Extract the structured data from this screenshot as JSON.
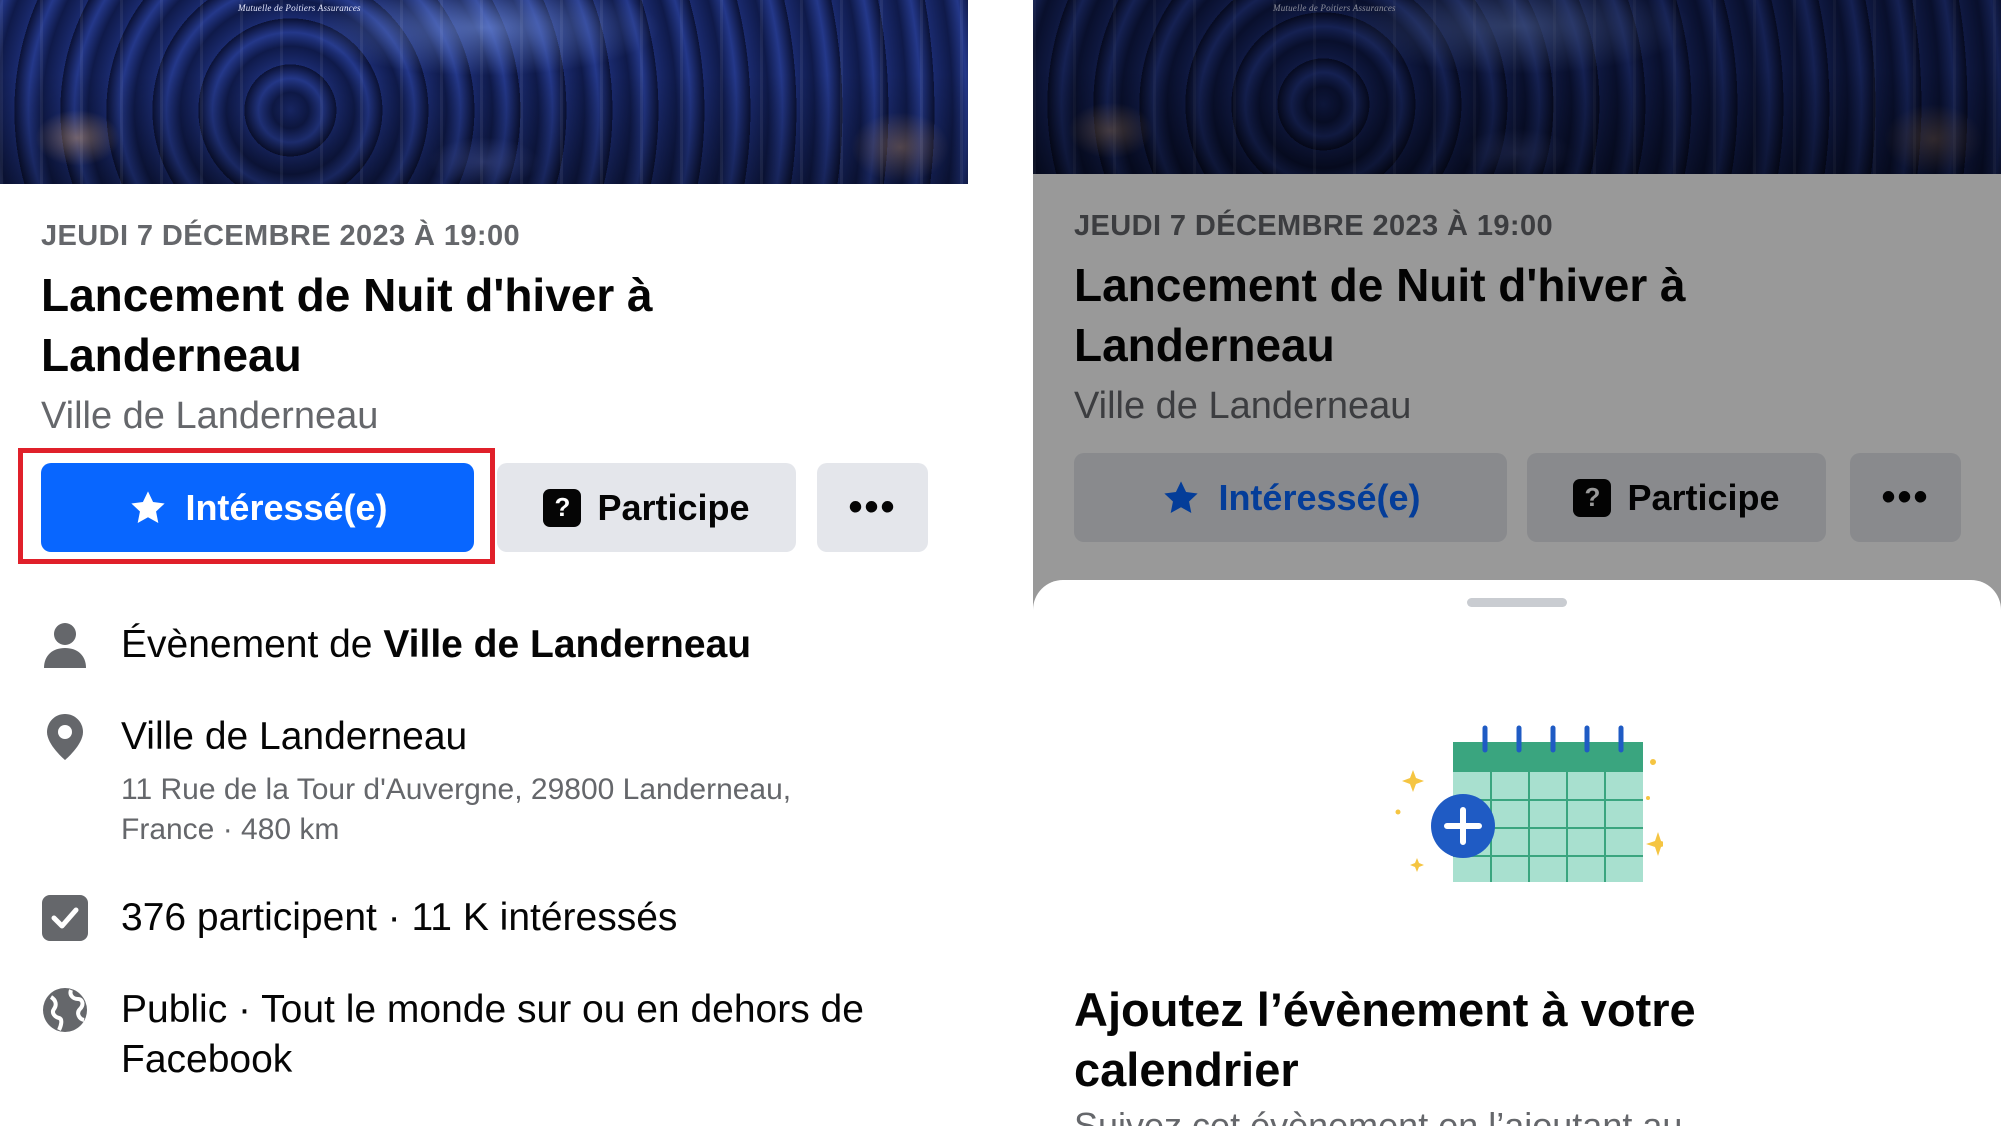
{
  "event": {
    "date": "JEUDI 7 DÉCEMBRE 2023 À 19:00",
    "title_line1": "Lancement de Nuit d'hiver à",
    "title_line2": "Landerneau",
    "host": "Ville de Landerneau",
    "cover_sign": "Mutuelle de Poitiers Assurances"
  },
  "actions": {
    "interested_label": "Intéressé(e)",
    "participe_label": "Participe",
    "more_label": "•••"
  },
  "details": {
    "organizer_prefix": "Évènement de ",
    "organizer_name": "Ville de Landerneau",
    "location_name": "Ville de Landerneau",
    "location_address_line1": "11 Rue de la Tour d'Auvergne, 29800 Landerneau,",
    "location_address_line2": "France · 480 km",
    "attendance": "376 participent · 11 K intéressés",
    "privacy_line1": "Public · Tout le monde sur ou en dehors de",
    "privacy_line2": "Facebook"
  },
  "sheet": {
    "title_line1": "Ajoutez l’évènement à votre",
    "title_line2": "calendrier",
    "subtitle": "Suivez cet évènement en l’ajoutant au"
  },
  "colors": {
    "primary_blue": "#0866ff",
    "highlight_red": "#e0202a",
    "secondary_gray": "#e4e6eb",
    "calendar_green": "#3aa57f",
    "calendar_light": "#a8e0cf"
  },
  "icons": {
    "star": "star-icon",
    "question": "question-box-icon",
    "person": "person-icon",
    "pin": "location-pin-icon",
    "check": "checkbox-icon",
    "globe": "globe-icon"
  }
}
